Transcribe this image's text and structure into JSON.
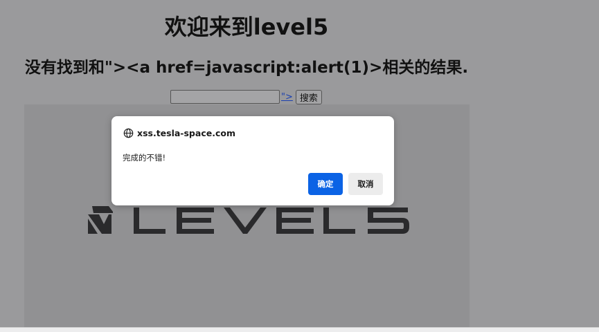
{
  "page": {
    "title": "欢迎来到level5",
    "result_text": "没有找到和\"><a href=javascript:alert(1)>相关的结果.",
    "search_value": "",
    "injected_link": "\">",
    "search_button": "搜索",
    "banner_logo_text": "LEVEL5",
    "background_color": "#9a9a9c"
  },
  "dialog": {
    "origin": "xss.tesla-space.com",
    "origin_icon": "globe-icon",
    "message": "完成的不错!",
    "ok_label": "确定",
    "cancel_label": "取消",
    "ok_color": "#0b63e5"
  }
}
